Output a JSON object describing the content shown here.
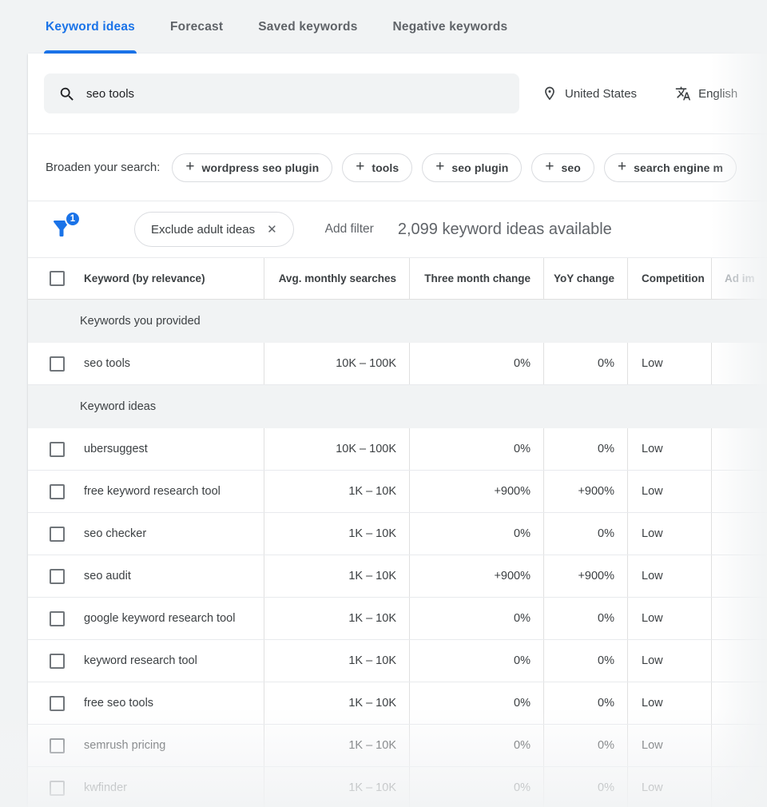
{
  "colors": {
    "accent": "#1a73e8",
    "text_primary": "#3c4043",
    "text_secondary": "#5f6368"
  },
  "tabs": [
    {
      "label": "Keyword ideas",
      "active": true
    },
    {
      "label": "Forecast",
      "active": false
    },
    {
      "label": "Saved keywords",
      "active": false
    },
    {
      "label": "Negative keywords",
      "active": false
    }
  ],
  "search": {
    "query": "seo tools",
    "location": "United States",
    "language": "English"
  },
  "broaden": {
    "label": "Broaden your search:",
    "chips": [
      "wordpress seo plugin",
      "tools",
      "seo plugin",
      "seo",
      "search engine m"
    ]
  },
  "filter_bar": {
    "badge_count": "1",
    "active_filter": "Exclude adult ideas",
    "remove_icon": "✕",
    "add_filter_label": "Add filter",
    "results_text": "2,099 keyword ideas available"
  },
  "table": {
    "columns": [
      "Keyword (by relevance)",
      "Avg. monthly searches",
      "Three month change",
      "YoY change",
      "Competition",
      "Ad im"
    ],
    "sections": [
      {
        "title": "Keywords you provided",
        "rows": [
          {
            "keyword": "seo tools",
            "avg_monthly_searches": "10K – 100K",
            "three_month_change": "0%",
            "yoy_change": "0%",
            "competition": "Low"
          }
        ]
      },
      {
        "title": "Keyword ideas",
        "rows": [
          {
            "keyword": "ubersuggest",
            "avg_monthly_searches": "10K – 100K",
            "three_month_change": "0%",
            "yoy_change": "0%",
            "competition": "Low"
          },
          {
            "keyword": "free keyword research tool",
            "avg_monthly_searches": "1K – 10K",
            "three_month_change": "+900%",
            "yoy_change": "+900%",
            "competition": "Low"
          },
          {
            "keyword": "seo checker",
            "avg_monthly_searches": "1K – 10K",
            "three_month_change": "0%",
            "yoy_change": "0%",
            "competition": "Low"
          },
          {
            "keyword": "seo audit",
            "avg_monthly_searches": "1K – 10K",
            "three_month_change": "+900%",
            "yoy_change": "+900%",
            "competition": "Low"
          },
          {
            "keyword": "google keyword research tool",
            "avg_monthly_searches": "1K – 10K",
            "three_month_change": "0%",
            "yoy_change": "0%",
            "competition": "Low"
          },
          {
            "keyword": "keyword research tool",
            "avg_monthly_searches": "1K – 10K",
            "three_month_change": "0%",
            "yoy_change": "0%",
            "competition": "Low"
          },
          {
            "keyword": "free seo tools",
            "avg_monthly_searches": "1K – 10K",
            "three_month_change": "0%",
            "yoy_change": "0%",
            "competition": "Low"
          },
          {
            "keyword": "semrush pricing",
            "avg_monthly_searches": "1K – 10K",
            "three_month_change": "0%",
            "yoy_change": "0%",
            "competition": "Low"
          },
          {
            "keyword": "kwfinder",
            "avg_monthly_searches": "1K – 10K",
            "three_month_change": "0%",
            "yoy_change": "0%",
            "competition": "Low"
          }
        ]
      }
    ]
  }
}
